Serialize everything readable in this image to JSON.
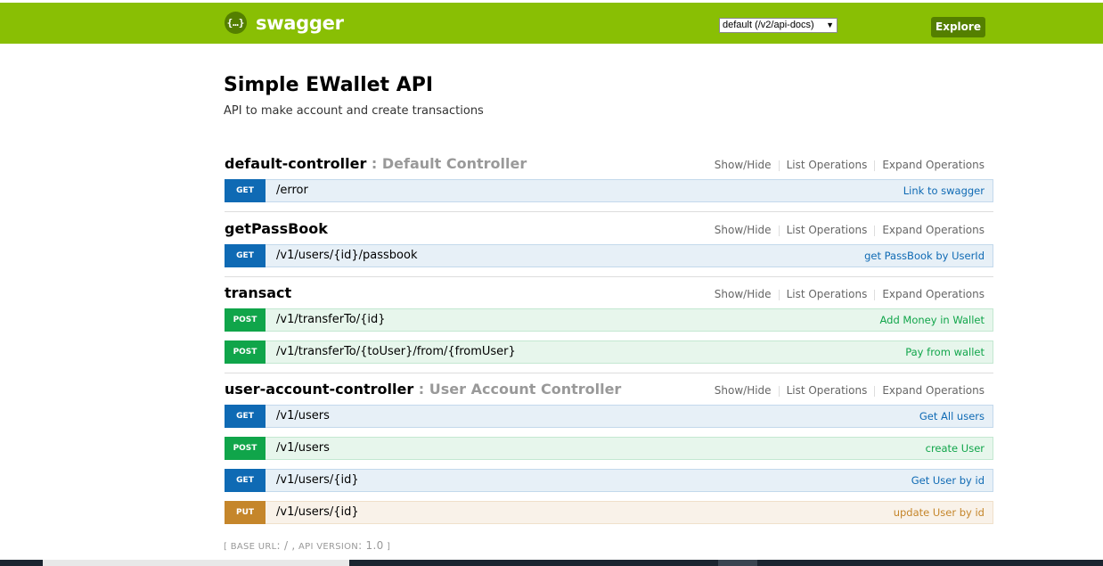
{
  "header": {
    "logo_icon_text": "{…}",
    "logo_text": "swagger",
    "spec_select_value": "default (/v2/api-docs)",
    "explore_label": "Explore",
    "colors": {
      "bar": "#89bf04",
      "dark": "#547f00"
    }
  },
  "info": {
    "title": "Simple EWallet API",
    "description": "API to make account and create transactions"
  },
  "resource_options": {
    "show_hide": "Show/Hide",
    "list_operations": "List Operations",
    "expand_operations": "Expand Operations"
  },
  "resources": [
    {
      "name": "default-controller",
      "separator": " : ",
      "description": "Default Controller",
      "operations": [
        {
          "method": "GET",
          "path": "/error",
          "summary": "Link to swagger"
        }
      ]
    },
    {
      "name": "getPassBook",
      "separator": "",
      "description": "",
      "operations": [
        {
          "method": "GET",
          "path": "/v1/users/{id}/passbook",
          "summary": "get PassBook by UserId"
        }
      ]
    },
    {
      "name": "transact",
      "separator": "",
      "description": "",
      "operations": [
        {
          "method": "POST",
          "path": "/v1/transferTo/{id}",
          "summary": "Add Money in Wallet"
        },
        {
          "method": "POST",
          "path": "/v1/transferTo/{toUser}/from/{fromUser}",
          "summary": "Pay from wallet"
        }
      ]
    },
    {
      "name": "user-account-controller",
      "separator": " : ",
      "description": "User Account Controller",
      "operations": [
        {
          "method": "GET",
          "path": "/v1/users",
          "summary": "Get All users"
        },
        {
          "method": "POST",
          "path": "/v1/users",
          "summary": "create User"
        },
        {
          "method": "GET",
          "path": "/v1/users/{id}",
          "summary": "Get User by id"
        },
        {
          "method": "PUT",
          "path": "/v1/users/{id}",
          "summary": "update User by id"
        }
      ]
    }
  ],
  "footer": {
    "open": "[",
    "base_url_label": "BASE URL",
    "base_url_value": ": / ,",
    "api_version_label": "API VERSION",
    "api_version_value": ": 1.0",
    "close": "]"
  },
  "method_colors": {
    "GET": "#0f6ab4",
    "POST": "#10a54a",
    "PUT": "#c5862b"
  }
}
